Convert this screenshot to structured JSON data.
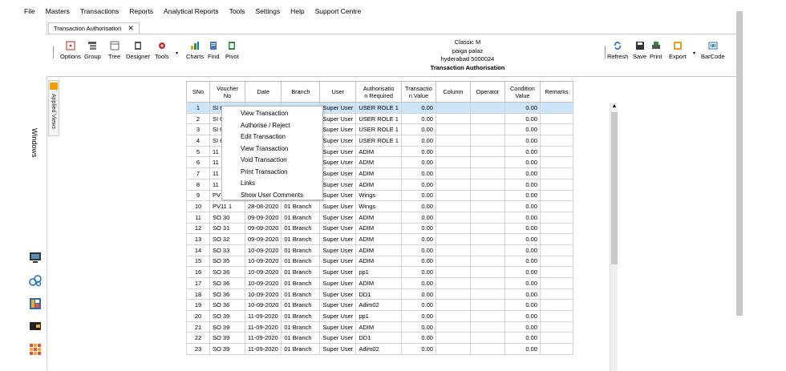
{
  "menu": [
    "File",
    "Masters",
    "Transactions",
    "Reports",
    "Analytical Reports",
    "Tools",
    "Settings",
    "Help",
    "Support Centre"
  ],
  "tab": {
    "label": "Transaction Authorisation",
    "close": "✕"
  },
  "toolbar_left": [
    {
      "label": "Options",
      "icon": "options-icon"
    },
    {
      "label": "Group",
      "icon": "group-icon"
    },
    {
      "label": "Tree",
      "icon": "tree-icon"
    },
    {
      "label": "Designer",
      "icon": "designer-icon"
    },
    {
      "label": "Tools",
      "icon": "tools-icon"
    },
    {
      "label": "Charts",
      "icon": "charts-icon"
    },
    {
      "label": "Find",
      "icon": "find-icon"
    },
    {
      "label": "Pivot",
      "icon": "pivot-icon"
    }
  ],
  "toolbar_right": [
    {
      "label": "Refresh",
      "icon": "refresh-icon"
    },
    {
      "label": "Save",
      "icon": "save-icon"
    },
    {
      "label": "Print",
      "icon": "print-icon"
    },
    {
      "label": "Export",
      "icon": "export-icon"
    },
    {
      "label": "BarCode",
      "icon": "barcode-icon"
    }
  ],
  "company": {
    "name": "Classic M",
    "line2": "paiga palaz",
    "line3": "hyderabad 5000024",
    "title": "Transaction Authorisation"
  },
  "side": {
    "windows": "Windows",
    "applied_views": "Applied Views"
  },
  "columns": [
    "SNo",
    "Voucher No",
    "Date",
    "Branch",
    "User",
    "Authorisation Required",
    "Transaction Value",
    "Column",
    "Operator",
    "Condition Value",
    "Remarks"
  ],
  "column_display": [
    "SNo",
    "Voucher\nNo",
    "Date",
    "Branch",
    "User",
    "Authorisatio\nn Required",
    "Transactio\nn Value",
    "Column",
    "Operator",
    "Condition\nValue",
    "Remarks"
  ],
  "rows": [
    [
      "1",
      "SI 6",
      "",
      "",
      "Super User",
      "USER ROLE 1",
      "0.00",
      "",
      "",
      "0.00",
      ""
    ],
    [
      "2",
      "SI 6",
      "",
      "",
      "Super User",
      "USER ROLE 1",
      "0.00",
      "",
      "",
      "0.00",
      ""
    ],
    [
      "3",
      "SI 6",
      "",
      "",
      "Super User",
      "USER ROLE 1",
      "0.00",
      "",
      "",
      "0.00",
      ""
    ],
    [
      "4",
      "SI 6",
      "",
      "",
      "Super User",
      "USER ROLE 1",
      "0.00",
      "",
      "",
      "0.00",
      ""
    ],
    [
      "5",
      "11",
      "",
      "",
      "Super User",
      "ADIM",
      "0.00",
      "",
      "",
      "0.00",
      ""
    ],
    [
      "6",
      "11",
      "",
      "",
      "Super User",
      "ADIM",
      "0.00",
      "",
      "",
      "0.00",
      ""
    ],
    [
      "7",
      "11",
      "",
      "",
      "Super User",
      "ADIM",
      "0.00",
      "",
      "",
      "0.00",
      ""
    ],
    [
      "8",
      "11",
      "",
      "",
      "Super User",
      "ADIM",
      "0.00",
      "",
      "",
      "0.00",
      ""
    ],
    [
      "9",
      "PV",
      "",
      "",
      "Super User",
      "Wings",
      "0.00",
      "",
      "",
      "0.00",
      ""
    ],
    [
      "10",
      "PV11 1",
      "28-08-2020",
      "01 Branch",
      "Super User",
      "Wings",
      "0.00",
      "",
      "",
      "0.00",
      ""
    ],
    [
      "11",
      "SO 30",
      "09-09-2020",
      "01 Branch",
      "Super User",
      "ADIM",
      "0.00",
      "",
      "",
      "0.00",
      ""
    ],
    [
      "12",
      "SO 31",
      "09-09-2020",
      "01 Branch",
      "Super User",
      "ADIM",
      "0.00",
      "",
      "",
      "0.00",
      ""
    ],
    [
      "13",
      "SO 32",
      "09-09-2020",
      "01 Branch",
      "Super User",
      "ADIM",
      "0.00",
      "",
      "",
      "0.00",
      ""
    ],
    [
      "14",
      "SO 33",
      "10-09-2020",
      "01 Branch",
      "Super User",
      "ADIM",
      "0.00",
      "",
      "",
      "0.00",
      ""
    ],
    [
      "15",
      "SO 35",
      "10-09-2020",
      "01 Branch",
      "Super User",
      "ADIM",
      "0.00",
      "",
      "",
      "0.00",
      ""
    ],
    [
      "16",
      "SO 36",
      "10-09-2020",
      "01 Branch",
      "Super User",
      "pp1",
      "0.00",
      "",
      "",
      "0.00",
      ""
    ],
    [
      "17",
      "SO 36",
      "10-09-2020",
      "01 Branch",
      "Super User",
      "ADIM",
      "0.00",
      "",
      "",
      "0.00",
      ""
    ],
    [
      "18",
      "SO 36",
      "10-09-2020",
      "01 Branch",
      "Super User",
      "DD1",
      "0.00",
      "",
      "",
      "0.00",
      ""
    ],
    [
      "19",
      "SO 36",
      "10-09-2020",
      "01 Branch",
      "Super User",
      "Adim02",
      "0.00",
      "",
      "",
      "0.00",
      ""
    ],
    [
      "20",
      "SO 39",
      "11-09-2020",
      "01 Branch",
      "Super User",
      "pp1",
      "0.00",
      "",
      "",
      "0.00",
      ""
    ],
    [
      "21",
      "SO 39",
      "11-09-2020",
      "01 Branch",
      "Super User",
      "ADIM",
      "0.00",
      "",
      "",
      "0.00",
      ""
    ],
    [
      "22",
      "SO 39",
      "11-09-2020",
      "01 Branch",
      "Super User",
      "DD1",
      "0.00",
      "",
      "",
      "0.00",
      ""
    ],
    [
      "23",
      "SO 39",
      "11-09-2020",
      "01 Branch",
      "Super User",
      "Adim02",
      "0.00",
      "",
      "",
      "0.00",
      ""
    ]
  ],
  "context_menu": [
    "View Transaction",
    "Authorise / Reject",
    "Edit Transaction",
    "View Transaction",
    "Void Transaction",
    "Print Transaction",
    "Links",
    "Show User Comments"
  ],
  "colors": {
    "selection": "#cce4f7",
    "accent": "#1e6fc0"
  }
}
